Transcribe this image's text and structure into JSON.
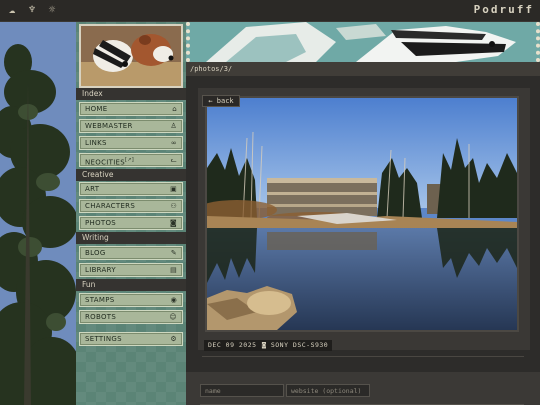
{
  "topbar": {
    "brand": "Podruff",
    "icons": [
      "cloud-icon",
      "tooth-icon",
      "sun-icon"
    ]
  },
  "sidebar": {
    "sections": [
      {
        "title": "Index",
        "items": [
          {
            "label": "HOME",
            "icon": "home-icon"
          },
          {
            "label": "WEBMASTER",
            "icon": "person-icon"
          },
          {
            "label": "LINKS",
            "icon": "link-icon"
          },
          {
            "label": "NEOCITIES",
            "icon": "cat-icon",
            "suffix": "[↗]"
          }
        ]
      },
      {
        "title": "Creative",
        "items": [
          {
            "label": "ART",
            "icon": "image-icon"
          },
          {
            "label": "CHARACTERS",
            "icon": "people-icon"
          },
          {
            "label": "PHOTOS",
            "icon": "camera-icon"
          }
        ]
      },
      {
        "title": "Writing",
        "items": [
          {
            "label": "BLOG",
            "icon": "quill-icon"
          },
          {
            "label": "LIBRARY",
            "icon": "book-icon"
          }
        ]
      },
      {
        "title": "Fun",
        "items": [
          {
            "label": "STAMPS",
            "icon": "stamp-icon"
          },
          {
            "label": "ROBOTS",
            "icon": "robot-icon"
          }
        ]
      }
    ],
    "settings": {
      "label": "SETTINGS",
      "icon": "gear-icon"
    }
  },
  "main": {
    "path": "/photos/3/",
    "back_label": "← back",
    "photo_date": "DEC 09 2025",
    "camera": "SONY DSC-S930",
    "form": {
      "name_placeholder": "name",
      "website_placeholder": "website (optional)"
    }
  },
  "colors": {
    "sidebar_bg": "#5b8476",
    "nav_button": "#a9b79a",
    "section_bar": "#353330",
    "banner": "#6aa5a8"
  }
}
